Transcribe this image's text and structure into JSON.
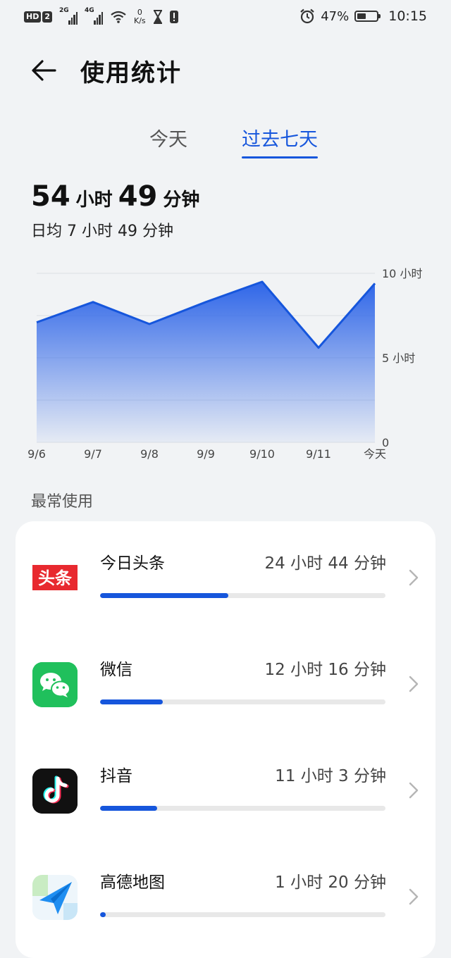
{
  "status_bar": {
    "hd_badge": "HD",
    "sim2_label": "2",
    "signal1_label": "2G",
    "signal2_label": "4G",
    "net_speed_value": "0",
    "net_speed_unit": "K/s",
    "battery_percent": "47%",
    "battery_level": 0.47,
    "time": "10:15"
  },
  "header": {
    "title": "使用统计",
    "back_icon": "arrow-left-icon"
  },
  "tabs": [
    {
      "label": "今天",
      "active": false
    },
    {
      "label": "过去七天",
      "active": true
    }
  ],
  "summary": {
    "total_hours": "54",
    "hour_unit": "小时",
    "total_minutes": "49",
    "minute_unit": "分钟",
    "daily_avg": "日均 7 小时 49 分钟"
  },
  "chart_data": {
    "type": "area",
    "categories": [
      "9/6",
      "9/7",
      "9/8",
      "9/9",
      "9/10",
      "9/11",
      "今天"
    ],
    "values": [
      7.1,
      8.3,
      7.0,
      8.3,
      9.5,
      5.6,
      9.4
    ],
    "ylim": [
      0,
      10
    ],
    "y_ticks": [
      {
        "value": 10,
        "label": "10 小时"
      },
      {
        "value": 5,
        "label": "5 小时"
      },
      {
        "value": 0,
        "label": "0"
      }
    ],
    "grid": true,
    "color": "#1656dc"
  },
  "most_used": {
    "section_label": "最常使用",
    "apps": [
      {
        "name": "今日头条",
        "time": "24 小时 44 分钟",
        "fraction": 0.45,
        "icon": "toutiao-icon"
      },
      {
        "name": "微信",
        "time": "12 小时 16 分钟",
        "fraction": 0.22,
        "icon": "wechat-icon"
      },
      {
        "name": "抖音",
        "time": "11 小时 3 分钟",
        "fraction": 0.2,
        "icon": "douyin-icon"
      },
      {
        "name": "高德地图",
        "time": "1 小时 20 分钟",
        "fraction": 0.02,
        "icon": "amap-icon"
      }
    ]
  },
  "colors": {
    "accent": "#1656dc",
    "background": "#f1f3f5",
    "card": "#ffffff"
  }
}
